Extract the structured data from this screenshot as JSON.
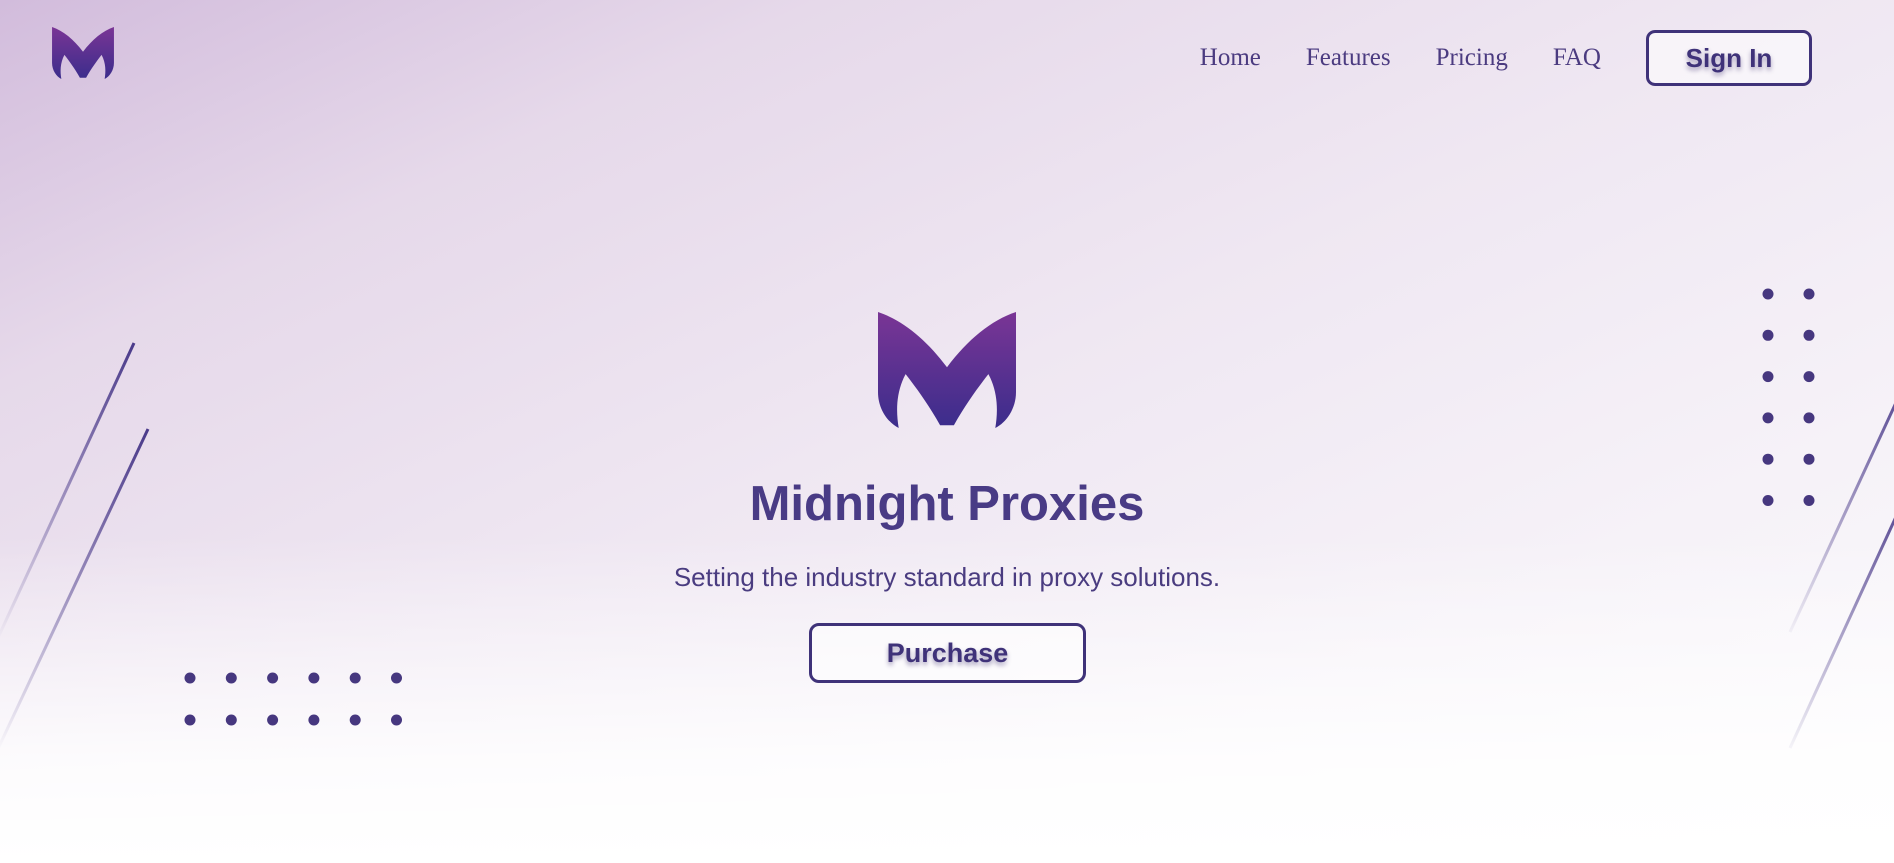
{
  "brand": {
    "logo_icon": "midnight-m-logo-icon",
    "name": "Midnight Proxies",
    "tagline": "Setting the industry standard in proxy solutions."
  },
  "nav": {
    "links": [
      {
        "label": "Home"
      },
      {
        "label": "Features"
      },
      {
        "label": "Pricing"
      },
      {
        "label": "FAQ"
      }
    ],
    "sign_in_label": "Sign In"
  },
  "hero": {
    "purchase_label": "Purchase"
  },
  "colors": {
    "primary": "#3f3279",
    "logo_top": "#7a3595",
    "logo_bottom": "#3b2d8c",
    "background_top": "#d2bcdc",
    "background_bottom": "#ffffff"
  }
}
